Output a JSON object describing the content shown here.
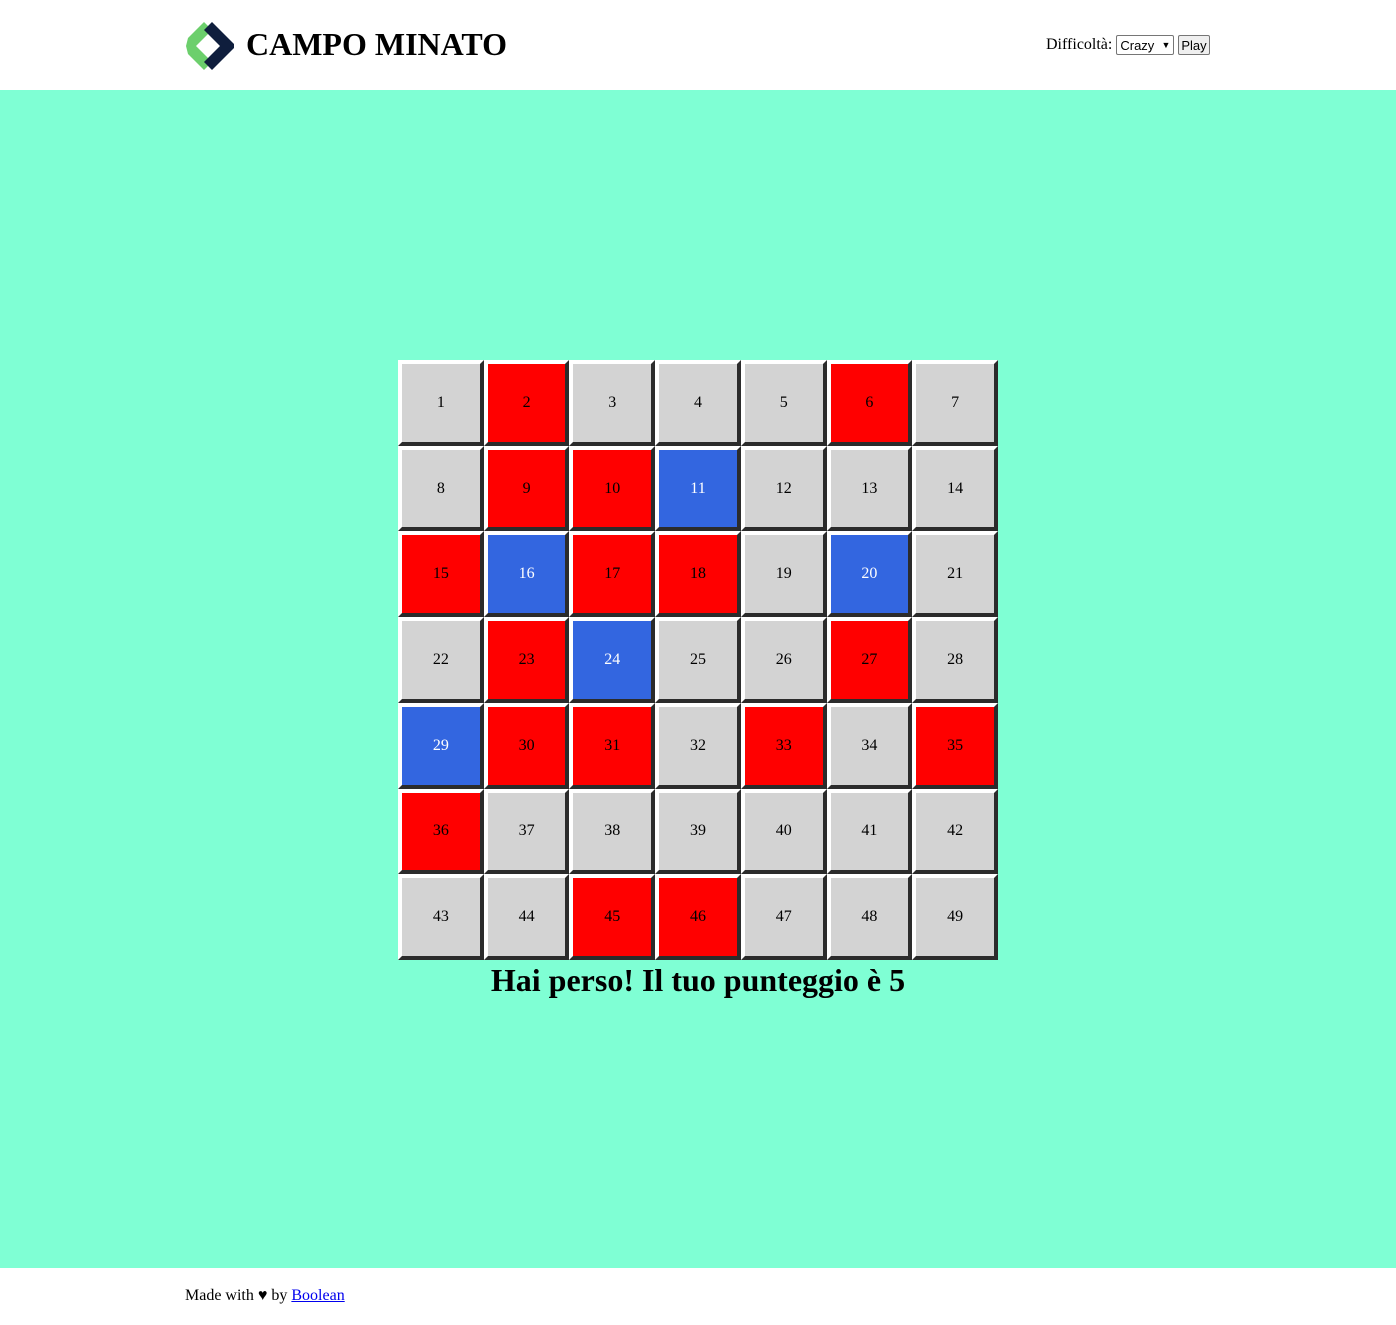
{
  "header": {
    "title": "CAMPO MINATO",
    "logo_icon": "diamond-chevron-logo",
    "difficulty_label": "Difficoltà:",
    "difficulty_selected": "Crazy",
    "play_label": "Play"
  },
  "colors": {
    "background": "#7fffd4",
    "cell_default": "#d3d3d3",
    "cell_bomb": "#ff0000",
    "cell_safe": "#3366e0"
  },
  "board": {
    "cells": [
      {
        "n": "1",
        "s": "hidden"
      },
      {
        "n": "2",
        "s": "bomb"
      },
      {
        "n": "3",
        "s": "hidden"
      },
      {
        "n": "4",
        "s": "hidden"
      },
      {
        "n": "5",
        "s": "hidden"
      },
      {
        "n": "6",
        "s": "bomb"
      },
      {
        "n": "7",
        "s": "hidden"
      },
      {
        "n": "8",
        "s": "hidden"
      },
      {
        "n": "9",
        "s": "bomb"
      },
      {
        "n": "10",
        "s": "bomb"
      },
      {
        "n": "11",
        "s": "safe"
      },
      {
        "n": "12",
        "s": "hidden"
      },
      {
        "n": "13",
        "s": "hidden"
      },
      {
        "n": "14",
        "s": "hidden"
      },
      {
        "n": "15",
        "s": "bomb"
      },
      {
        "n": "16",
        "s": "safe"
      },
      {
        "n": "17",
        "s": "bomb"
      },
      {
        "n": "18",
        "s": "bomb"
      },
      {
        "n": "19",
        "s": "hidden"
      },
      {
        "n": "20",
        "s": "safe"
      },
      {
        "n": "21",
        "s": "hidden"
      },
      {
        "n": "22",
        "s": "hidden"
      },
      {
        "n": "23",
        "s": "bomb"
      },
      {
        "n": "24",
        "s": "safe"
      },
      {
        "n": "25",
        "s": "hidden"
      },
      {
        "n": "26",
        "s": "hidden"
      },
      {
        "n": "27",
        "s": "bomb"
      },
      {
        "n": "28",
        "s": "hidden"
      },
      {
        "n": "29",
        "s": "safe"
      },
      {
        "n": "30",
        "s": "bomb"
      },
      {
        "n": "31",
        "s": "bomb"
      },
      {
        "n": "32",
        "s": "hidden"
      },
      {
        "n": "33",
        "s": "bomb"
      },
      {
        "n": "34",
        "s": "hidden"
      },
      {
        "n": "35",
        "s": "bomb"
      },
      {
        "n": "36",
        "s": "bomb"
      },
      {
        "n": "37",
        "s": "hidden"
      },
      {
        "n": "38",
        "s": "hidden"
      },
      {
        "n": "39",
        "s": "hidden"
      },
      {
        "n": "40",
        "s": "hidden"
      },
      {
        "n": "41",
        "s": "hidden"
      },
      {
        "n": "42",
        "s": "hidden"
      },
      {
        "n": "43",
        "s": "hidden"
      },
      {
        "n": "44",
        "s": "hidden"
      },
      {
        "n": "45",
        "s": "bomb"
      },
      {
        "n": "46",
        "s": "bomb"
      },
      {
        "n": "47",
        "s": "hidden"
      },
      {
        "n": "48",
        "s": "hidden"
      },
      {
        "n": "49",
        "s": "hidden"
      }
    ]
  },
  "result": {
    "message": "Hai perso! Il tuo punteggio è 5"
  },
  "footer": {
    "made_with": "Made with",
    "heart": "♥",
    "by": "by",
    "link_text": "Boolean"
  }
}
